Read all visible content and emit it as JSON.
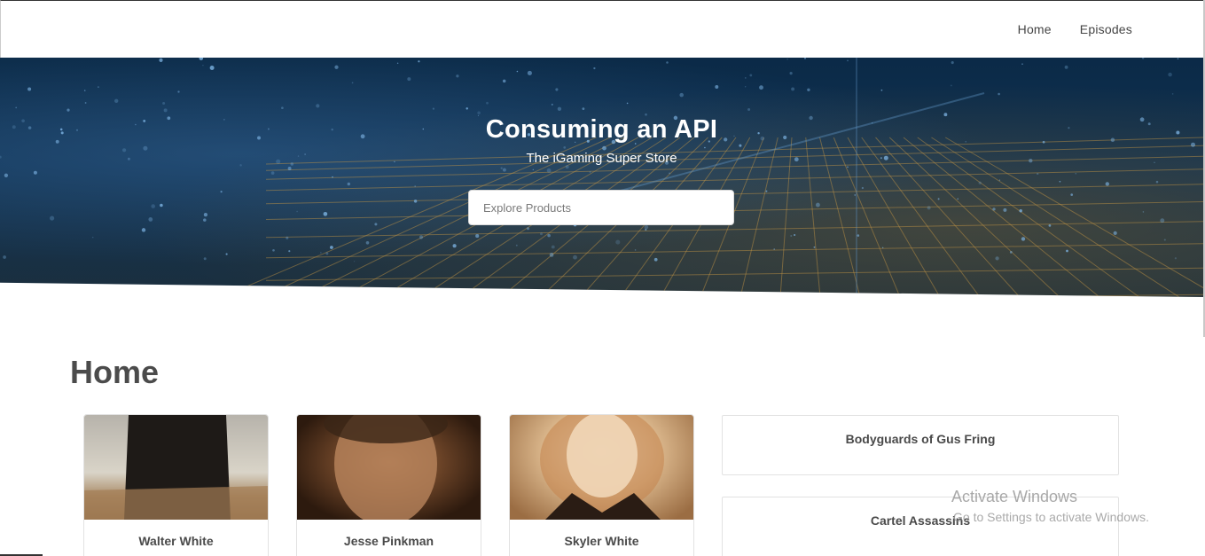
{
  "nav": {
    "items": [
      "Home",
      "Episodes"
    ]
  },
  "hero": {
    "title": "Consuming an API",
    "subtitle": "The iGaming Super Store",
    "search_placeholder": "Explore Products"
  },
  "main": {
    "title": "Home",
    "characters": [
      {
        "name": "Walter White"
      },
      {
        "name": "Jesse Pinkman"
      },
      {
        "name": "Skyler White"
      }
    ],
    "groups": [
      {
        "name": "Bodyguards of Gus Fring"
      },
      {
        "name": "Cartel Assassins"
      }
    ]
  },
  "overlay": {
    "activate_title": "Activate Windows",
    "activate_sub": "Go to Settings to activate Windows."
  },
  "colors": {
    "hero_dark": "#0b2a47",
    "grid_gold": "#c99a45",
    "text": "#4a4a4a"
  }
}
